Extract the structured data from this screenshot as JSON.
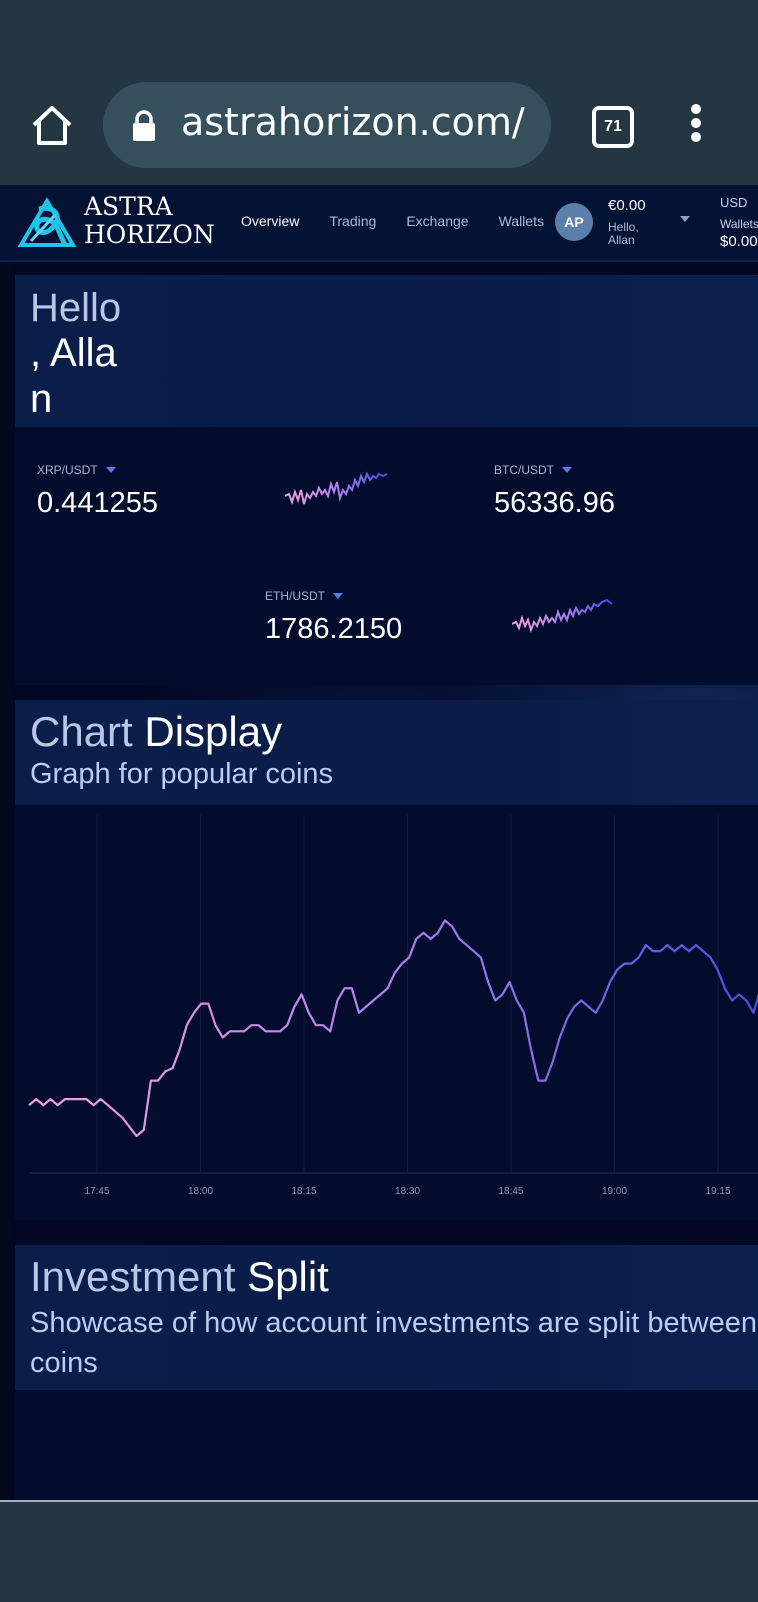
{
  "browser": {
    "url": "astrahorizon.com/",
    "tab_count": "71"
  },
  "nav": {
    "logo_line1": "ASTRA",
    "logo_line2": "HORIZON",
    "links": [
      "Overview",
      "Trading",
      "Exchange",
      "Wallets"
    ],
    "active": "Overview"
  },
  "account": {
    "avatar_initials": "AP",
    "balance": "€0.00",
    "greeting": "Hello, Allan",
    "currency": "USD",
    "wallets_label": "Wallets",
    "wallets_value": "$0.00"
  },
  "hello": {
    "title": "Hello",
    "name": ", Allan"
  },
  "tickers": [
    {
      "pair": "XRP/USDT",
      "price": "0.441255"
    },
    {
      "pair": "BTC/USDT",
      "price": "56336.96"
    },
    {
      "pair": "ETH/USDT",
      "price": "1786.2150"
    }
  ],
  "chart_section": {
    "title_light": "Chart",
    "title_bold": "Display",
    "subtitle": "Graph for popular coins"
  },
  "investment_section": {
    "title_light": "Investment",
    "title_bold": "Split",
    "subtitle": "Showcase of how account investments are split between coins"
  },
  "colors": {
    "gradient_start": "#f4a3d8",
    "gradient_mid": "#a77df0",
    "gradient_end": "#3d4fe0"
  },
  "chart_data": {
    "type": "line",
    "x_ticks": [
      "17:45",
      "18:00",
      "18:15",
      "18:30",
      "18:45",
      "19:00",
      "19:15"
    ],
    "x_range": [
      0,
      104
    ],
    "y_range": [
      0,
      100
    ],
    "series": [
      {
        "values": [
          22,
          24,
          22,
          24,
          22,
          24,
          24,
          24,
          24,
          22,
          24,
          22,
          20,
          18,
          15,
          12,
          14,
          30,
          30,
          33,
          34,
          40,
          48,
          52,
          55,
          55,
          48,
          44,
          46,
          46,
          46,
          48,
          48,
          46,
          46,
          46,
          48,
          54,
          58,
          52,
          48,
          48,
          46,
          56,
          60,
          60,
          52,
          54,
          56,
          58,
          60,
          65,
          68,
          70,
          76,
          78,
          76,
          78,
          82,
          80,
          76,
          74,
          72,
          70,
          62,
          56,
          58,
          62,
          56,
          52,
          40,
          30,
          30,
          36,
          44,
          50,
          54,
          56,
          54,
          52,
          56,
          62,
          66,
          68,
          68,
          70,
          74,
          72,
          72,
          74,
          72,
          74,
          72,
          74,
          72,
          70,
          66,
          60,
          56,
          58,
          56,
          52,
          60,
          66,
          70
        ]
      }
    ]
  }
}
